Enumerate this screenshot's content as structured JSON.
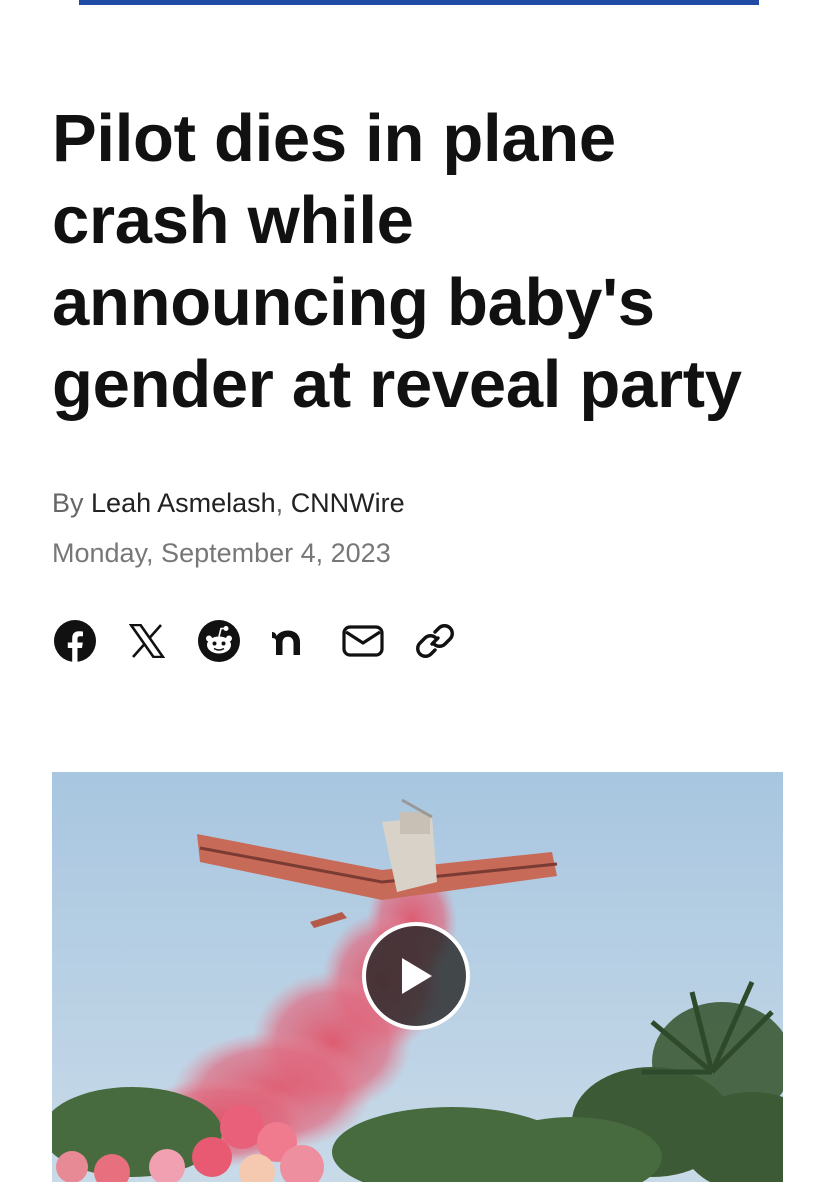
{
  "article": {
    "headline": "Pilot dies in plane crash while announcing baby's gender at reveal party",
    "byline_prefix": "By",
    "author": "Leah Asmelash",
    "separator": ",",
    "source": "CNNWire",
    "date": "Monday, September 4, 2023"
  },
  "share": {
    "icons": [
      "facebook-icon",
      "x-icon",
      "reddit-icon",
      "nextdoor-icon",
      "email-icon",
      "link-icon"
    ]
  },
  "video": {
    "play_icon": "play-icon"
  },
  "colors": {
    "accent_bar": "#1f4ba5",
    "headline": "#111111",
    "meta": "#777777"
  }
}
